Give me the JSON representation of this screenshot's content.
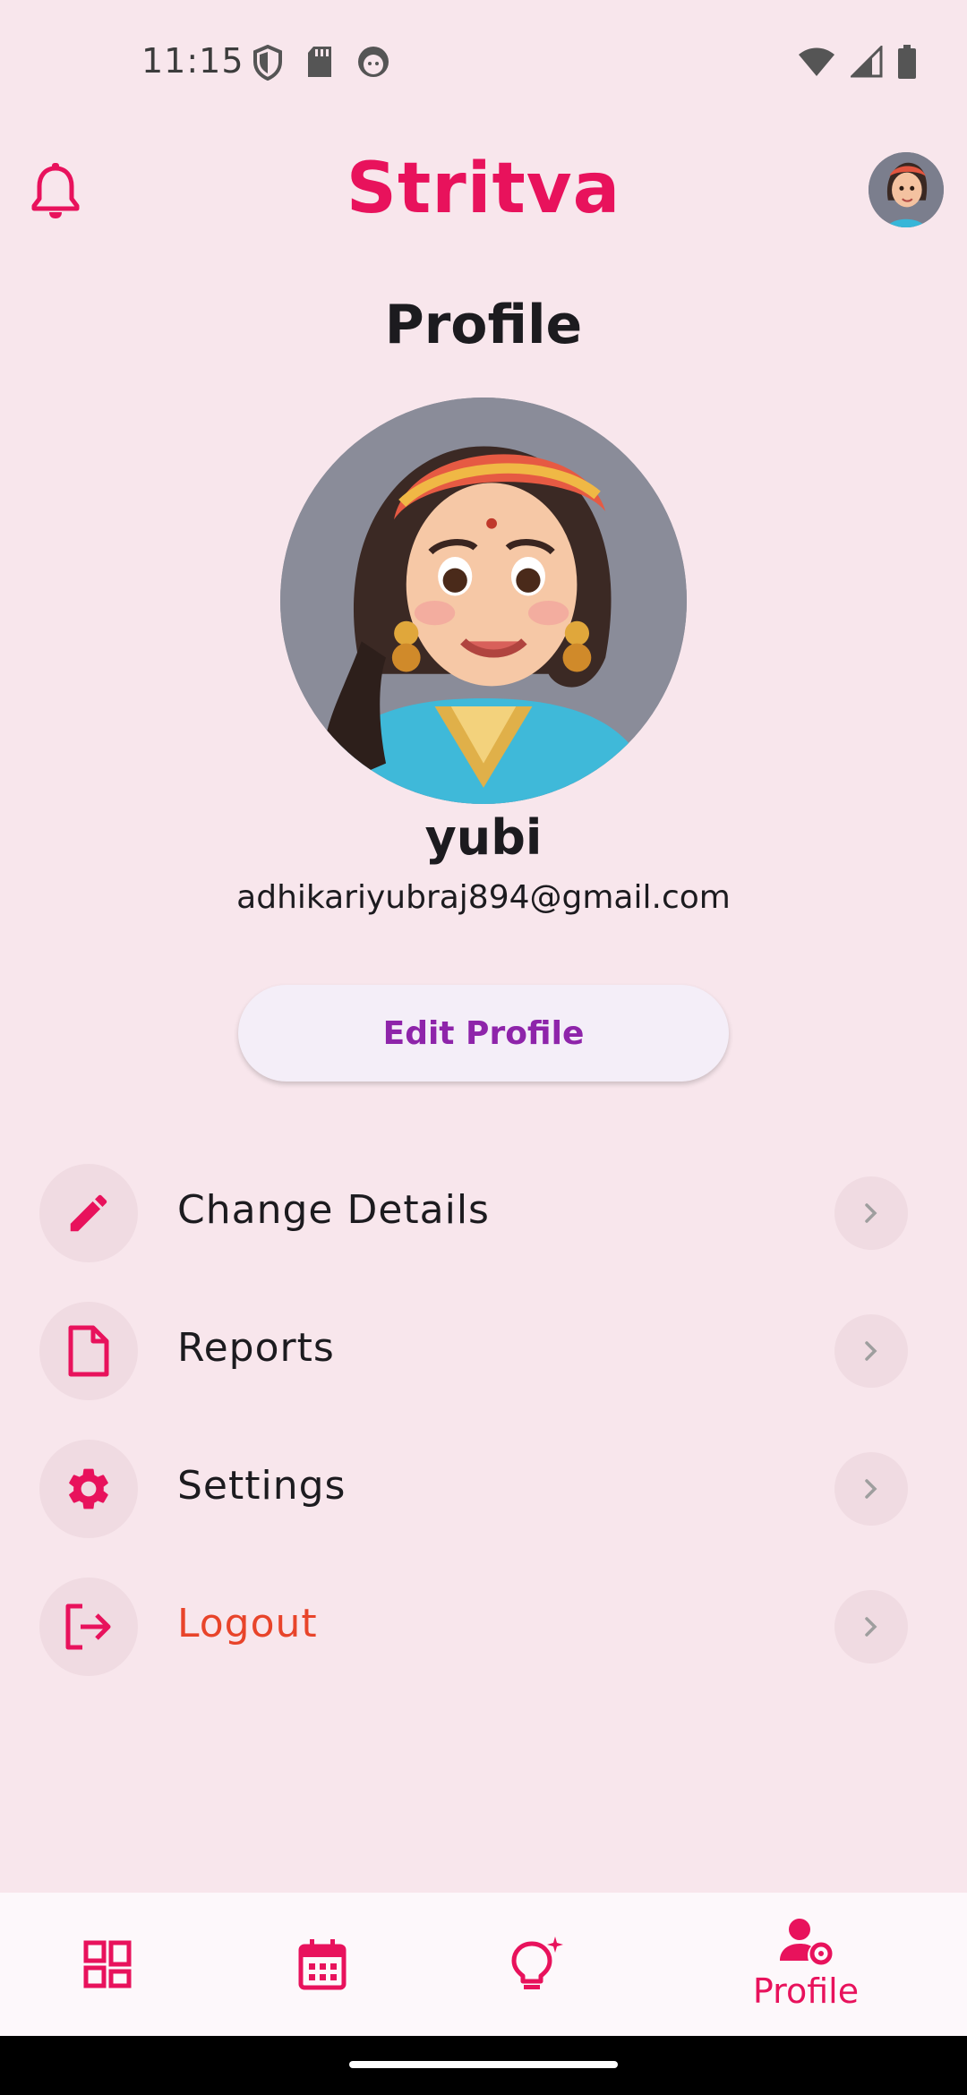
{
  "status_bar": {
    "time": "11:15",
    "left_icons": [
      "shield-icon",
      "sd-card-icon",
      "face-icon"
    ],
    "right_icons": [
      "wifi-icon",
      "signal-icon",
      "battery-icon"
    ]
  },
  "header": {
    "brand": "Stritva",
    "brand_color": "#e8125c",
    "left_icon": "bell-icon",
    "right_icon": "avatar"
  },
  "page_title": "Profile",
  "user": {
    "name": "yubi",
    "email": "adhikariyubraj894@gmail.com"
  },
  "edit_button_label": "Edit Profile",
  "menu": {
    "items": [
      {
        "label": "Change Details",
        "icon": "pencil-icon"
      },
      {
        "label": "Reports",
        "icon": "document-icon"
      },
      {
        "label": "Settings",
        "icon": "gear-icon"
      },
      {
        "label": "Logout",
        "icon": "logout-icon",
        "color": "#e8442a"
      }
    ]
  },
  "bottom_nav": {
    "items": [
      {
        "icon": "dashboard-icon",
        "label": ""
      },
      {
        "icon": "calendar-icon",
        "label": ""
      },
      {
        "icon": "lightbulb-icon",
        "label": ""
      },
      {
        "icon": "profile-settings-icon",
        "label": "Profile",
        "active": true
      }
    ]
  }
}
